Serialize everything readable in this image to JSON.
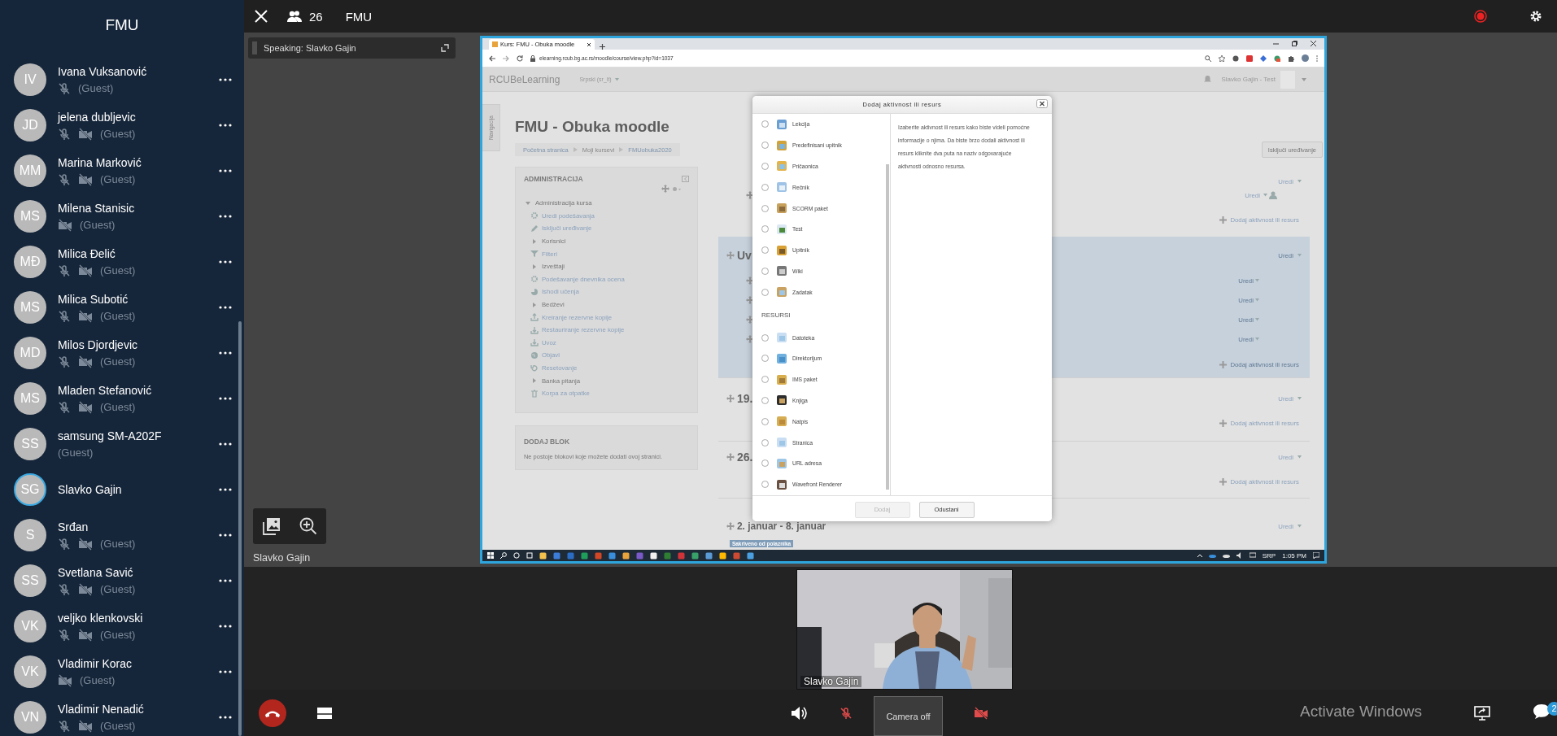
{
  "top_bar": {
    "participant_count": "26",
    "title": "FMU"
  },
  "sidebar": {
    "title": "FMU",
    "participants": [
      {
        "initials": "IV",
        "name": "Ivana Vuksanović",
        "role": "(Guest)",
        "mic_muted": true,
        "camera_off": false,
        "speaking": false
      },
      {
        "initials": "JD",
        "name": "jelena dubljevic",
        "role": "(Guest)",
        "mic_muted": true,
        "camera_off": true,
        "speaking": false
      },
      {
        "initials": "MM",
        "name": "Marina Marković",
        "role": "(Guest)",
        "mic_muted": true,
        "camera_off": true,
        "speaking": false
      },
      {
        "initials": "MS",
        "name": "Milena Stanisic",
        "role": "(Guest)",
        "mic_muted": false,
        "camera_off": true,
        "speaking": false
      },
      {
        "initials": "MĐ",
        "name": "Milica Đelić",
        "role": "(Guest)",
        "mic_muted": true,
        "camera_off": true,
        "speaking": false
      },
      {
        "initials": "MS",
        "name": "Milica Subotić",
        "role": "(Guest)",
        "mic_muted": true,
        "camera_off": true,
        "speaking": false
      },
      {
        "initials": "MD",
        "name": "Milos Djordjevic",
        "role": "(Guest)",
        "mic_muted": true,
        "camera_off": true,
        "speaking": false
      },
      {
        "initials": "MS",
        "name": "Mladen Stefanović",
        "role": "(Guest)",
        "mic_muted": true,
        "camera_off": true,
        "speaking": false
      },
      {
        "initials": "SS",
        "name": "samsung SM-A202F",
        "role": "(Guest)",
        "mic_muted": false,
        "camera_off": false,
        "speaking": false
      },
      {
        "initials": "SG",
        "name": "Slavko Gajin",
        "mic_muted": false,
        "camera_off": false,
        "speaking": true
      },
      {
        "initials": "S",
        "name": "Srđan",
        "role": "(Guest)",
        "mic_muted": true,
        "camera_off": true,
        "speaking": false
      },
      {
        "initials": "SS",
        "name": "Svetlana Savić",
        "role": "(Guest)",
        "mic_muted": true,
        "camera_off": true,
        "speaking": false
      },
      {
        "initials": "VK",
        "name": "veljko klenkovski",
        "role": "(Guest)",
        "mic_muted": true,
        "camera_off": true,
        "speaking": false
      },
      {
        "initials": "VK",
        "name": "Vladimir Korac",
        "role": "(Guest)",
        "mic_muted": false,
        "camera_off": true,
        "speaking": false
      },
      {
        "initials": "VN",
        "name": "Vladimir Nenadić",
        "role": "(Guest)",
        "mic_muted": true,
        "camera_off": true,
        "speaking": false
      }
    ]
  },
  "stage": {
    "speaking_label": "Speaking: Slavko Gajin",
    "presenter_name": "Slavko Gajin",
    "shared_screen": {
      "browser": {
        "tab_title": "Kurs: FMU - Obuka moodle",
        "url": "elearning.rcub.bg.ac.rs/moodle/course/view.php?id=1037"
      },
      "moodle": {
        "brand": "RCUBeLearning",
        "language": "Srpski (sr_lt)",
        "user_name": "Slavko Gajin - Test",
        "drawer_tab": "Navigacija",
        "course_title": "FMU - Obuka moodle",
        "breadcrumbs": [
          "Početna stranica",
          "Moji kursevi",
          "FMUobuka2020"
        ],
        "edit_button": "Isključi uređivanje",
        "admin_block": {
          "title": "ADMINISTRACIJA",
          "tree": [
            {
              "label": "Administracija kursa",
              "kind": "branch",
              "expanded": true,
              "children": [
                {
                  "label": "Uredi podešavanja",
                  "kind": "link"
                },
                {
                  "label": "Isključi uređivanje",
                  "kind": "link"
                },
                {
                  "label": "Korisnici",
                  "kind": "branch",
                  "expanded": false
                },
                {
                  "label": "Filteri",
                  "kind": "link"
                },
                {
                  "label": "Izveštaji",
                  "kind": "branch",
                  "expanded": false
                },
                {
                  "label": "Podešavanje dnevnika ocena",
                  "kind": "link"
                },
                {
                  "label": "Ishodi učenja",
                  "kind": "link"
                },
                {
                  "label": "Bedževi",
                  "kind": "branch",
                  "expanded": false
                },
                {
                  "label": "Kreiranje rezervne kopije",
                  "kind": "link"
                },
                {
                  "label": "Restauriranje rezervne kopije",
                  "kind": "link"
                },
                {
                  "label": "Uvoz",
                  "kind": "link"
                },
                {
                  "label": "Objavi",
                  "kind": "link"
                },
                {
                  "label": "Resetovanje",
                  "kind": "link"
                },
                {
                  "label": "Banka pitanja",
                  "kind": "branch",
                  "expanded": false
                },
                {
                  "label": "Korpa za otpatke",
                  "kind": "link"
                }
              ]
            }
          ]
        },
        "add_block": {
          "title": "DODAJ BLOK",
          "text": "Ne postoje blokovi koje možete dodati ovoj stranici."
        },
        "sections": [
          {
            "highlighted": false,
            "edit_links": [
              {
                "label": "Uredi",
                "kind": "section"
              },
              {
                "label": "Uredi",
                "kind": "user"
              }
            ],
            "add_link": "Dodaj aktivnost ili resurs"
          },
          {
            "heading": "Uv",
            "highlighted": true,
            "edit_links": [
              {
                "label": "Uredi",
                "kind": "section"
              },
              {
                "label": "Uredi",
                "kind": "item"
              },
              {
                "label": "Uredi",
                "kind": "item"
              },
              {
                "label": "Uredi",
                "kind": "item"
              },
              {
                "label": "Uredi",
                "kind": "item"
              }
            ],
            "add_link": "Dodaj aktivnost ili resurs"
          },
          {
            "heading": "19.",
            "highlighted": false,
            "edit_links": [
              {
                "label": "Uredi",
                "kind": "section"
              }
            ],
            "add_link": "Dodaj aktivnost ili resurs"
          },
          {
            "heading": "26.",
            "highlighted": false,
            "edit_links": [
              {
                "label": "Uredi",
                "kind": "section"
              }
            ],
            "add_link": "Dodaj aktivnost ili resurs"
          },
          {
            "heading": "2. januar - 8. januar",
            "highlighted": false,
            "edit_links": [
              {
                "label": "Uredi",
                "kind": "section"
              }
            ],
            "badge": "Sakriveno od polaznika"
          }
        ]
      },
      "dialog": {
        "title": "Dodaj aktivnost ili resurs",
        "activities": [
          {
            "label": "Lekcija",
            "selected": false
          },
          {
            "label": "Predefinisani upitnik",
            "selected": false
          },
          {
            "label": "Pričaonica",
            "selected": false
          },
          {
            "label": "Rečnik",
            "selected": false
          },
          {
            "label": "SCORM paket",
            "selected": false
          },
          {
            "label": "Test",
            "selected": false
          },
          {
            "label": "Upitnik",
            "selected": false
          },
          {
            "label": "Wiki",
            "selected": false
          },
          {
            "label": "Zadatak",
            "selected": false
          }
        ],
        "resources_heading": "RESURSI",
        "resources": [
          {
            "label": "Datoteka",
            "selected": false
          },
          {
            "label": "Direktorijum",
            "selected": false
          },
          {
            "label": "IMS paket",
            "selected": false
          },
          {
            "label": "Knjiga",
            "selected": false
          },
          {
            "label": "Natpis",
            "selected": false
          },
          {
            "label": "Stranica",
            "selected": false
          },
          {
            "label": "URL adresa",
            "selected": false
          },
          {
            "label": "Wavefront Renderer",
            "selected": false
          }
        ],
        "help": "Izaberite aktivnost ili resurs kako biste videli pomoćne informacije o njima. Da biste brzo dodali aktivnost ili resurs kliknite dva puta na naziv odgovarajuće aktivnosti odnosno resursa.",
        "buttons": [
          {
            "label": "Dodaj",
            "disabled": true
          },
          {
            "label": "Odustani",
            "disabled": false
          }
        ]
      },
      "taskbar": {
        "language": "SRP",
        "time": "1:05 PM"
      }
    },
    "video": {
      "name": "Slavko Gajin"
    }
  },
  "bottom_bar": {
    "camera_button": "Camera off",
    "chat_badge": "2",
    "os_notice": "Activate Windows"
  }
}
